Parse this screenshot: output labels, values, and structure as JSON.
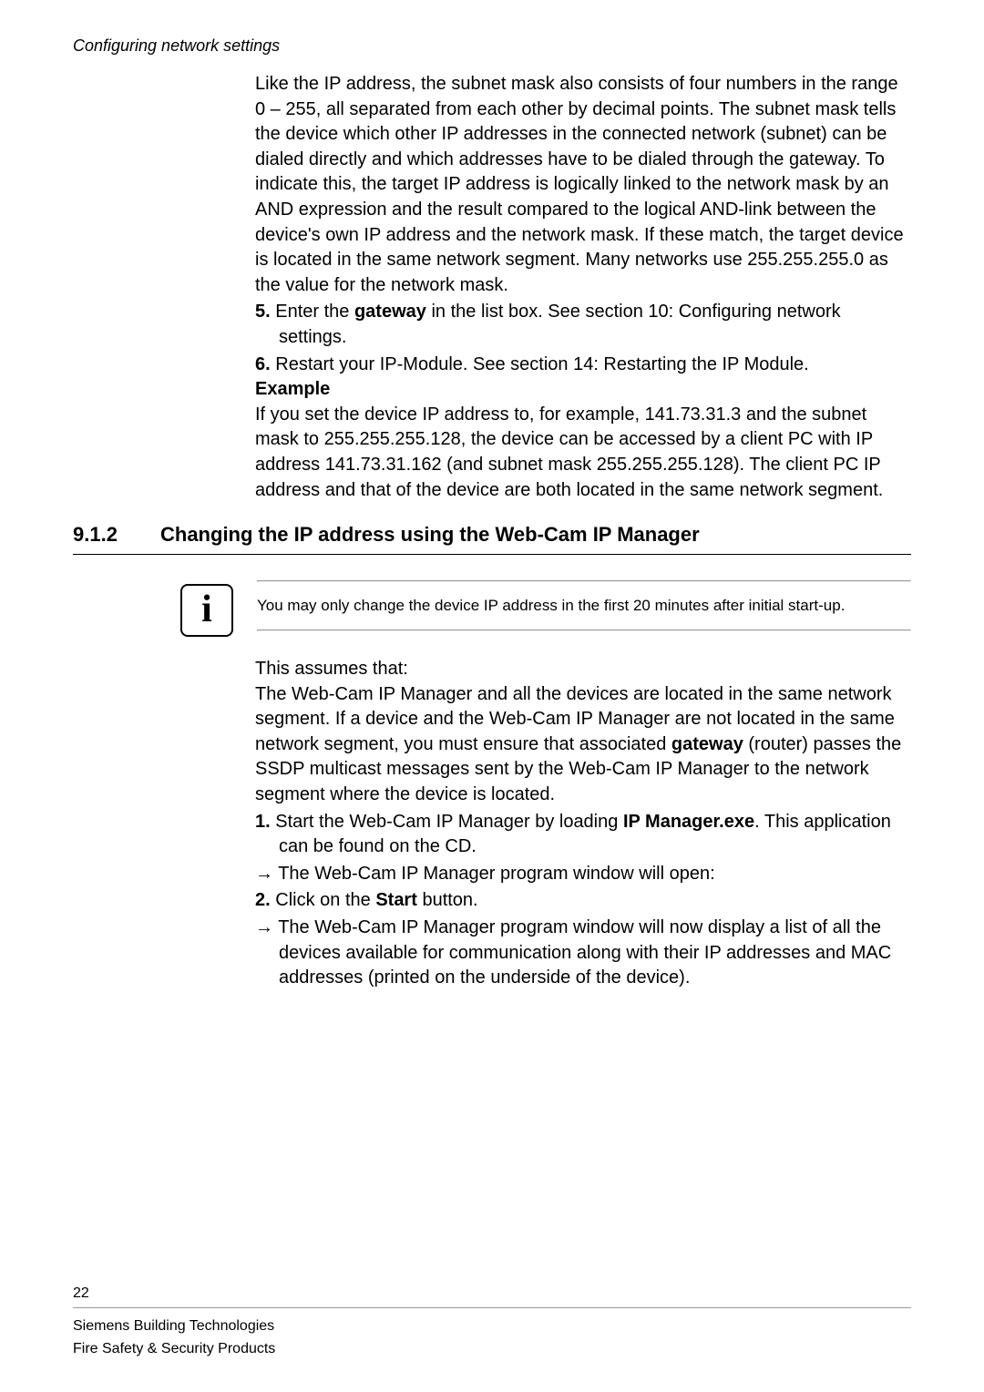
{
  "header": {
    "running_title": "Configuring network settings"
  },
  "body1": {
    "p1": "Like the IP address, the subnet mask also consists of four numbers in the range 0 – 255, all separated from each other by decimal points. The subnet mask tells the device which other IP addresses in the connected network (subnet) can be dialed directly and which addresses have to be dialed through the gateway. To indicate this, the target IP address is logically linked to the network mask by an AND expression and the result compared to the logical AND-link between the device's own IP address and the network mask. If these match, the target device is located in the same network segment. Many networks use 255.255.255.0 as the value for the network mask.",
    "step5_pre": "5. ",
    "step5_a": "Enter the ",
    "step5_bold": "gateway",
    "step5_b": " in the list box. See section 10: Configuring network settings.",
    "step6_pre": "6. ",
    "step6": "Restart your IP-Module. See section 14: Restarting the IP Module.",
    "example_head": "Example",
    "example_body": "If you set the device IP address to, for example, 141.73.31.3 and the subnet mask to 255.255.255.128, the device can be accessed by a client PC with IP address 141.73.31.162 (and subnet mask 255.255.255.128). The client PC IP address and that of the device are both located in the same network segment."
  },
  "section": {
    "num": "9.1.2",
    "title": "Changing the IP address using the Web-Cam IP Manager"
  },
  "info": {
    "icon_glyph": "i",
    "note": "You may only change the device IP address in the first 20 minutes after initial start-up."
  },
  "body2": {
    "lead": "This assumes that:",
    "p_a": "The Web-Cam IP Manager and all the devices are located in the same network segment. If a device and the Web-Cam IP Manager are not located in the same network segment, you must ensure that associated ",
    "p_bold": "gateway",
    "p_b": " (router) passes the SSDP multicast messages sent by the Web-Cam IP Manager to the network segment where the device is located.",
    "s1_pre": "1. ",
    "s1_a": "Start the Web-Cam IP Manager by loading ",
    "s1_bold": "IP Manager.exe",
    "s1_b": ". This application can be found on the CD.",
    "a1_pre": "→ ",
    "a1": "The Web-Cam IP Manager program window will open:",
    "s2_pre": "2. ",
    "s2_a": "Click on the ",
    "s2_bold": "Start",
    "s2_b": " button.",
    "a2_pre": "→ ",
    "a2": "The Web-Cam IP Manager program window will now display a list of all the devices available for communication along with their IP addresses and MAC addresses (printed on the underside of the device)."
  },
  "footer": {
    "page": "22",
    "line1": "Siemens Building Technologies",
    "line2": "Fire Safety & Security Products"
  }
}
